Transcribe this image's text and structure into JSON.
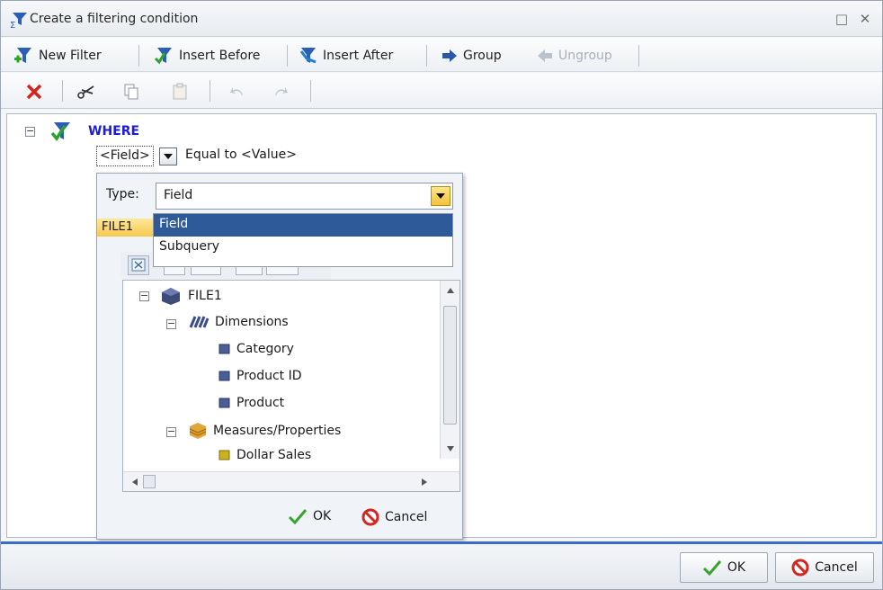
{
  "window": {
    "title": "Create a filtering condition"
  },
  "toolbar": {
    "new_filter": "New Filter",
    "insert_before": "Insert Before",
    "insert_after": "Insert After",
    "group": "Group",
    "ungroup": "Ungroup"
  },
  "editor": {
    "where": "WHERE",
    "field_token": "<Field>",
    "operator_text": "Equal to",
    "value_token": "<Value>"
  },
  "popup": {
    "type_label": "Type:",
    "type_value": "Field",
    "file_tab": "FILE1",
    "options": [
      "Field",
      "Subquery"
    ],
    "selected_option": "Field",
    "tree": {
      "root": "FILE1",
      "dimensions": "Dimensions",
      "category": "Category",
      "product_id": "Product ID",
      "product": "Product",
      "measures": "Measures/Properties",
      "dollar_sales": "Dollar Sales"
    },
    "ok": "OK",
    "cancel": "Cancel"
  },
  "footer": {
    "ok": "OK",
    "cancel": "Cancel"
  },
  "colors": {
    "accent": "#3c6cc9",
    "where": "#1b1bd8",
    "selection": "#2f5a9a",
    "highlight": "#f6c94f"
  }
}
